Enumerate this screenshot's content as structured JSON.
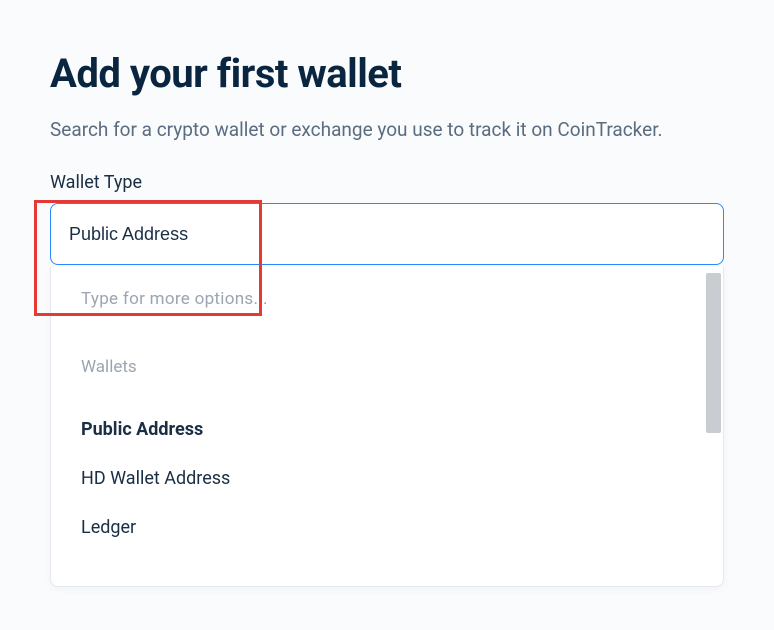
{
  "header": {
    "title": "Add your first wallet",
    "subtitle": "Search for a crypto wallet or exchange you use to track it on CoinTracker."
  },
  "walletType": {
    "label": "Wallet Type",
    "value": "Public Address"
  },
  "dropdown": {
    "hint": "Type for more options...",
    "group_label": "Wallets",
    "options": [
      {
        "label": "Public Address",
        "selected": true
      },
      {
        "label": "HD Wallet Address",
        "selected": false
      },
      {
        "label": "Ledger",
        "selected": false
      }
    ]
  }
}
